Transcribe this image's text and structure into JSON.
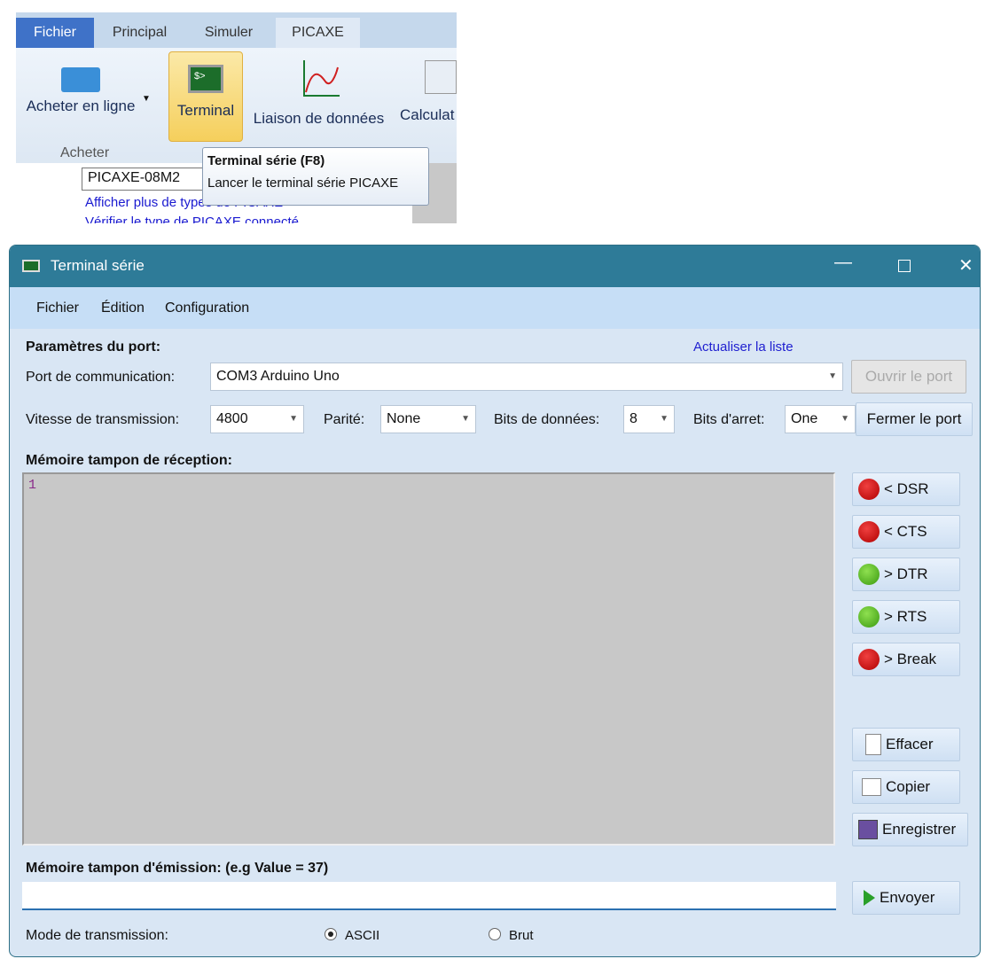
{
  "ribbon": {
    "tabs": [
      "Fichier",
      "Principal",
      "Simuler",
      "PICAXE"
    ],
    "buttons": {
      "buy": "Acheter en ligne",
      "terminal": "Terminal",
      "datalink": "Liaison de données",
      "calc": "Calculat"
    },
    "group": "Acheter",
    "tree": {
      "chip": "PICAXE-08M2",
      "link1": "Afficher plus de types de PICAXE",
      "link2": "Vérifier le type de PICAXE connecté"
    },
    "tooltip": {
      "title": "Terminal série (F8)",
      "desc": "Lancer le terminal série PICAXE"
    }
  },
  "window": {
    "title": "Terminal série",
    "menu": [
      "Fichier",
      "Édition",
      "Configuration"
    ]
  },
  "port": {
    "heading": "Paramètres du port:",
    "refresh": "Actualiser la liste",
    "com_label": "Port de communication:",
    "com_value": "COM3 Arduino Uno",
    "open": "Ouvrir le port",
    "close": "Fermer le port",
    "baud_label": "Vitesse de transmission:",
    "baud": "4800",
    "parity_label": "Parité:",
    "parity": "None",
    "bits_label": "Bits de données:",
    "bits": "8",
    "stop_label": "Bits d'arret:",
    "stop": "One"
  },
  "rx": {
    "heading": "Mémoire tampon de réception:",
    "content": "1"
  },
  "signals": [
    {
      "label": "< DSR",
      "state": "red"
    },
    {
      "label": "< CTS",
      "state": "red"
    },
    {
      "label": "> DTR",
      "state": "green"
    },
    {
      "label": "> RTS",
      "state": "green"
    },
    {
      "label": "> Break",
      "state": "red"
    }
  ],
  "actions": {
    "clear": "Effacer",
    "copy": "Copier",
    "save": "Enregistrer",
    "send": "Envoyer"
  },
  "tx": {
    "heading": "Mémoire tampon d'émission: (e.g Value = 37)",
    "value": "",
    "mode_label": "Mode de transmission:",
    "ascii": "ASCII",
    "raw": "Brut",
    "selected": "ASCII"
  }
}
